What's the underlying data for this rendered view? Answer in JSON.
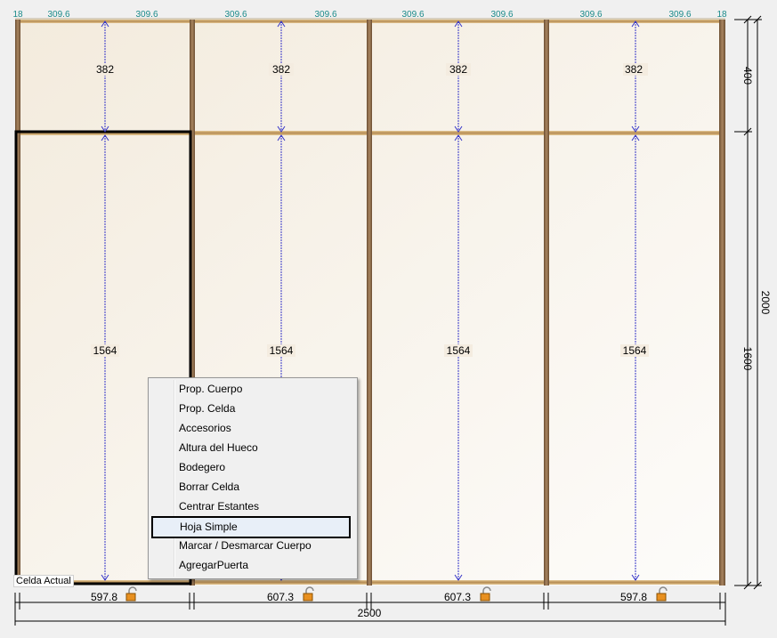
{
  "top_widths": {
    "col1": [
      "18",
      "309.6",
      "309.6"
    ],
    "col2": [
      "309.6",
      "309.6"
    ],
    "col3": [
      "309.6",
      "309.6"
    ],
    "col4": [
      "309.6",
      "309.6",
      "18"
    ]
  },
  "upper_heights": [
    "382",
    "382",
    "382",
    "382"
  ],
  "lower_heights": [
    "1564",
    "1564",
    "1564",
    "1564"
  ],
  "bottom_widths": [
    "597.8",
    "607.3",
    "607.3",
    "597.8"
  ],
  "total_width": "2500",
  "right_dims": {
    "upper": "400",
    "lower": "1600",
    "total": "2000"
  },
  "status_label": "Celda Actual",
  "context_menu": {
    "items": [
      "Prop. Cuerpo",
      "Prop. Celda",
      "Accesorios",
      "Altura del Hueco",
      "Bodegero",
      "Borrar Celda",
      "Centrar Estantes",
      "Hoja Simple",
      "Marcar / Desmarcar Cuerpo",
      "AgregarPuerta"
    ],
    "highlighted": "Hoja Simple"
  },
  "colors": {
    "panel_fill_top": "#f5eee2",
    "panel_fill_bottom": "#fbf9f6",
    "wood": "#9c7a55",
    "shelf": "#c8a060",
    "dimension_line": "#3030c0",
    "top_dim_text": "#1a8a8a"
  },
  "icons": [
    "padlock-icon",
    "padlock-icon",
    "padlock-icon",
    "padlock-icon"
  ]
}
